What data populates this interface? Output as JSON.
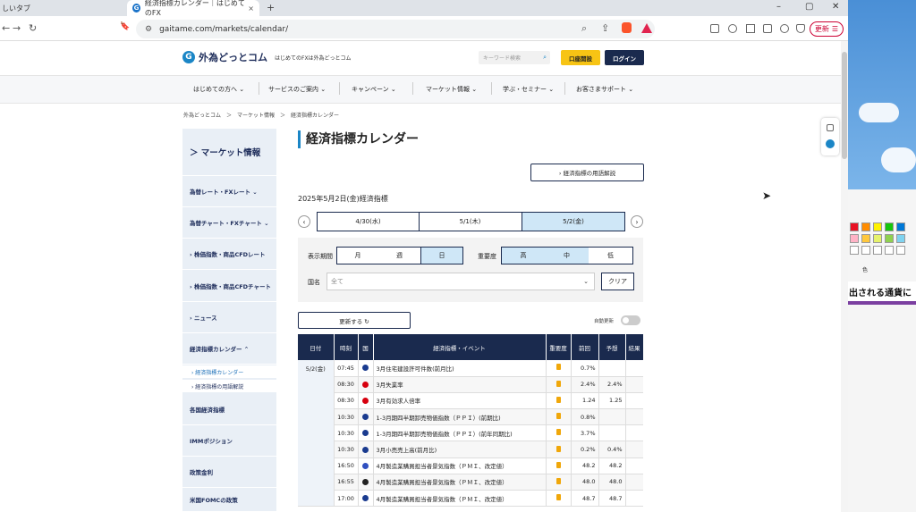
{
  "browser": {
    "prev_tab": "しいタブ",
    "active_tab": "経済指標カレンダー｜はじめてのFX",
    "active_tab_favicon": "G",
    "url": "gaitame.com/markets/calendar/",
    "update_button": "更新",
    "close_glyph": "×",
    "new_tab_glyph": "+",
    "minimize_glyph": "–",
    "restore_glyph": "▢",
    "close_window_glyph": "✕",
    "back_glyph": "←",
    "forward_glyph": "→",
    "reload_glyph": "↻",
    "bookmark_glyph": "🔖",
    "site_info_glyph": "⚙",
    "zoom_glyph": "⌕",
    "share_glyph": "⇪",
    "menu_glyph": "☰",
    "accent": "#1a73c9"
  },
  "site": {
    "logo_mark": "G",
    "logo": "外為どっとコム",
    "tagline": "はじめてのFXは外為どっとコム",
    "search_placeholder": "キーワード検索",
    "search_icon": "⌕",
    "open_account": "口座開設",
    "login": "ログイン",
    "nav": [
      {
        "label": "はじめての方へ ⌄"
      },
      {
        "label": "サービスのご案内 ⌄"
      },
      {
        "label": "キャンペーン ⌄"
      },
      {
        "label": "マーケット情報 ⌄"
      },
      {
        "label": "学ぶ・セミナー ⌄"
      },
      {
        "label": "お客さまサポート ⌄"
      }
    ],
    "breadcrumb": "外為どっとコム　＞　マーケット情報　＞　経済指標カレンダー"
  },
  "sidebar": {
    "title": "＞ マーケット情報",
    "items": [
      {
        "label": "為替レート・FXレート ⌄"
      },
      {
        "label": "為替チャート・FXチャート ⌄"
      },
      {
        "label": "› 株価指数・商品CFDレート"
      },
      {
        "label": "› 株価指数・商品CFDチャート"
      },
      {
        "label": "› ニュース"
      },
      {
        "label": "経済指標カレンダー ⌃"
      },
      {
        "label": "各国経済指標"
      },
      {
        "label": "IMMポジション"
      },
      {
        "label": "政策金利"
      },
      {
        "label": "米国FOMCの政策"
      }
    ],
    "sub": [
      {
        "label": "› 経済指標カレンダー"
      },
      {
        "label": "› 経済指標の用語解説"
      }
    ]
  },
  "main": {
    "title": "経済指標カレンダー",
    "glossary": "›  経済指標の用語解説",
    "date_label": "2025年5月2日(金)経済指標",
    "prev": "‹",
    "next": "›",
    "dates": [
      "4/30(水)",
      "5/1(木)",
      "5/2(金)"
    ],
    "period_label": "表示期間",
    "periods": [
      "月",
      "週",
      "日"
    ],
    "importance_label": "重要度",
    "importance": [
      "高",
      "中",
      "低"
    ],
    "country_label": "国名",
    "country_value": "全て",
    "country_chevron": "⌄",
    "clear": "クリア",
    "refresh": "更新する ↻",
    "auto_refresh": "自動更新"
  },
  "table": {
    "headers": [
      "日付",
      "時刻",
      "国",
      "経済指標・イベント",
      "重要度",
      "前回",
      "予想",
      "結果"
    ],
    "date": "5/2(金)",
    "rows": [
      {
        "time": "07:45",
        "flag": "#1a3b8f",
        "event": "3月住宅建設許可件数(前月比)",
        "prev": "0.7%",
        "fc": ""
      },
      {
        "time": "08:30",
        "flag": "#d7000f",
        "event": "3月失業率",
        "prev": "2.4%",
        "fc": "2.4%"
      },
      {
        "time": "08:30",
        "flag": "#d7000f",
        "event": "3月有効求人倍率",
        "prev": "1.24",
        "fc": "1.25"
      },
      {
        "time": "10:30",
        "flag": "#1a3b8f",
        "event": "1-3月期四半期卸売物価指数（ＰＰＩ）(前期比)",
        "prev": "0.8%",
        "fc": ""
      },
      {
        "time": "10:30",
        "flag": "#1a3b8f",
        "event": "1-3月期四半期卸売物価指数（ＰＰＩ）(前年同期比)",
        "prev": "3.7%",
        "fc": ""
      },
      {
        "time": "10:30",
        "flag": "#1a3b8f",
        "event": "3月小売売上高(前月比)",
        "prev": "0.2%",
        "fc": "0.4%"
      },
      {
        "time": "16:50",
        "flag": "#3050c0",
        "event": "4月製造業購買担当者景気指数（ＰＭＩ、改定値）",
        "prev": "48.2",
        "fc": "48.2"
      },
      {
        "time": "16:55",
        "flag": "#222222",
        "event": "4月製造業購買担当者景気指数（ＰＭＩ、改定値）",
        "prev": "48.0",
        "fc": "48.0"
      },
      {
        "time": "17:00",
        "flag": "#1a3b8f",
        "event": "4月製造業購買担当者景気指数（ＰＭＩ、改定値）",
        "prev": "48.7",
        "fc": "48.7"
      }
    ]
  },
  "overlay": {
    "paint_label": "色",
    "banner": "出される通貨に"
  }
}
